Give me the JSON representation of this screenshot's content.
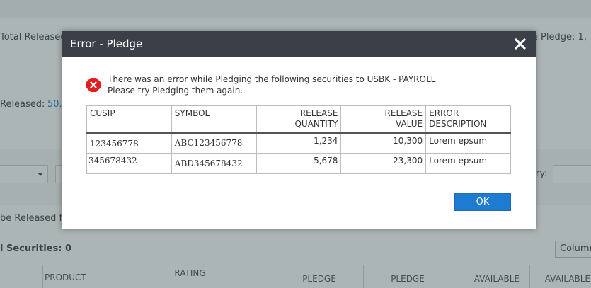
{
  "background": {
    "total_released_label": "Total Released",
    "pledge_label_fragment": "ble Pledge: 1,",
    "released_label": "Released:",
    "released_value": "50.",
    "query_fragment": "ry:",
    "released_from_fragment": "be Released fr",
    "securities_label": "l Securities: 0",
    "columns_button": "Column",
    "table_headers": {
      "product_type": "PRODUCT",
      "rating": "RATING",
      "pledge_quantity": "PLEDGE",
      "pledge_value": "PLEDGE",
      "available_quantity": "AVAILABLE",
      "available_value": "AVAILABLE"
    }
  },
  "dialog": {
    "title": "Error - Pledge",
    "close_icon": "close-icon",
    "error_icon": "error-icon",
    "message_line1": "There was an error while Pledging the following securities to USBK - PAYROLL",
    "message_line2": "Please try Pledging them again.",
    "columns": {
      "cusip": "CUSIP",
      "symbol": "SYMBOL",
      "release_quantity_1": "RELEASE",
      "release_quantity_2": "QUANTITY",
      "release_value_1": "RELEASE",
      "release_value_2": "VALUE",
      "error_description_1": "ERROR",
      "error_description_2": "DESCRIPTION"
    },
    "rows": [
      {
        "cusip": "123456778",
        "symbol": "ABC123456778",
        "release_quantity": "1,234",
        "release_value": "10,300",
        "error_description": "Lorem epsum"
      },
      {
        "cusip": "345678432",
        "symbol": "ABD345678432",
        "release_quantity": "5,678",
        "release_value": "23,300",
        "error_description": "Lorem epsum"
      }
    ],
    "ok_label": "OK",
    "colors": {
      "header": "#3b3f48",
      "ok_button": "#1f7ad1",
      "error_red": "#e02020"
    }
  }
}
